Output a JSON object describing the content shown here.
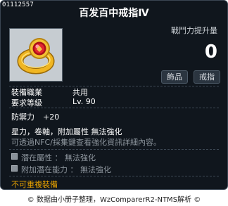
{
  "item_id": "01112557",
  "title": "百发百中戒指Ⅳ",
  "combat_power": {
    "label": "戰鬥力提升量",
    "value": "0"
  },
  "tags": [
    "飾品",
    "戒指"
  ],
  "info": {
    "job_label": "裝備職業",
    "job_value": "共用",
    "level_label": "要求等級",
    "level_value": "Lv. 90"
  },
  "stats": {
    "defense_label": "防禦力",
    "defense_value": "+20",
    "flags": "星力，卷軸，附加屬性 無法強化",
    "note": "可透過NFC/採集鍵查看強化資訊詳細內容。"
  },
  "potential": {
    "line1": "潛在屬性 ： 無法強化",
    "line2": "附加潛在能力 ： 無法強化"
  },
  "warning": "不可重複裝備",
  "footer": "© 数据由小册子整理，WzComparerR2-NTMS解析 ©",
  "colors": {
    "background": "#10161d",
    "warning": "#e8a200",
    "muted": "#8e969e"
  },
  "icons": {
    "item": "gold-ring-red-gem-icon"
  }
}
